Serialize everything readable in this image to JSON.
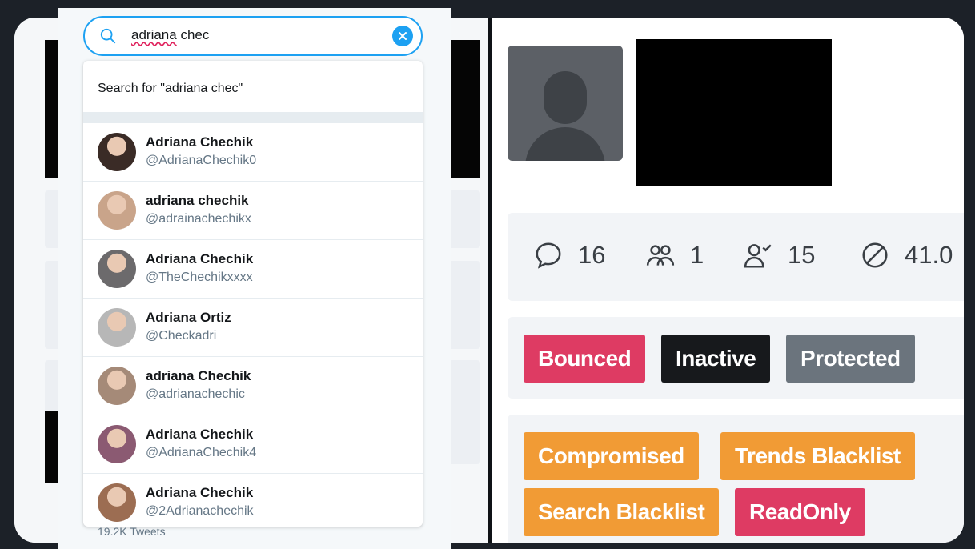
{
  "search": {
    "query_misspelled": "adriana",
    "query_rest": " chec",
    "search_for_label": "Search for \"adriana chec\""
  },
  "results": [
    {
      "name": "Adriana Chechik",
      "handle": "@AdrianaChechik0",
      "avatar_color": "#3a2b26"
    },
    {
      "name": "adriana chechik",
      "handle": "@adrainachechikx",
      "avatar_color": "#c9a48a"
    },
    {
      "name": "Adriana Chechik",
      "handle": "@TheChechikxxxx",
      "avatar_color": "#6c6a6c"
    },
    {
      "name": "Adriana Ortiz",
      "handle": "@Checkadri",
      "avatar_color": "#b7b7b7"
    },
    {
      "name": "adriana Chechik",
      "handle": "@adrianachechic",
      "avatar_color": "#a58a78"
    },
    {
      "name": "Adriana Chechik",
      "handle": "@AdrianaChechik4",
      "avatar_color": "#8b5a72"
    },
    {
      "name": "Adriana Chechik",
      "handle": "@2Adrianachechik",
      "avatar_color": "#9c6d52"
    }
  ],
  "tweets_count": "19.2K Tweets",
  "stats": {
    "replies": "16",
    "groups": "1",
    "following": "15",
    "blocked": "41.0"
  },
  "badges_status": [
    "Bounced",
    "Inactive",
    "Protected"
  ],
  "badges_flags": [
    "Compromised",
    "Trends Blacklist",
    "Search Blacklist",
    "ReadOnly"
  ],
  "colors": {
    "accent": "#1da1f2",
    "badge_red": "#de3b63",
    "badge_dark": "#17191c",
    "badge_gray": "#6b747d",
    "badge_orange": "#f19b35"
  }
}
